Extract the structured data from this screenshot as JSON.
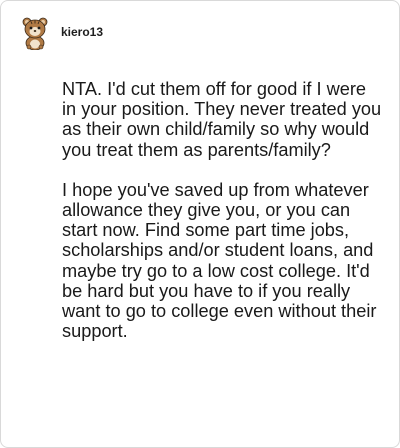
{
  "comment": {
    "author": "kiero13",
    "avatar_icon": "cartoon-bear-avatar-icon",
    "paragraphs": [
      "NTA. I'd cut them off for good if I were in your position. They never treated you as their own child/family so why would you treat them as parents/family?",
      "I hope you've saved up from whatever allowance they give you, or you can start now. Find some part time jobs, scholarships and/or student loans, and maybe try go to a low cost college. It'd be hard but you have to if you really want to go to college even without their support."
    ]
  },
  "colors": {
    "border": "#d9d9d9",
    "text": "#1a1a1a",
    "avatar_fur": "#b07a45"
  }
}
